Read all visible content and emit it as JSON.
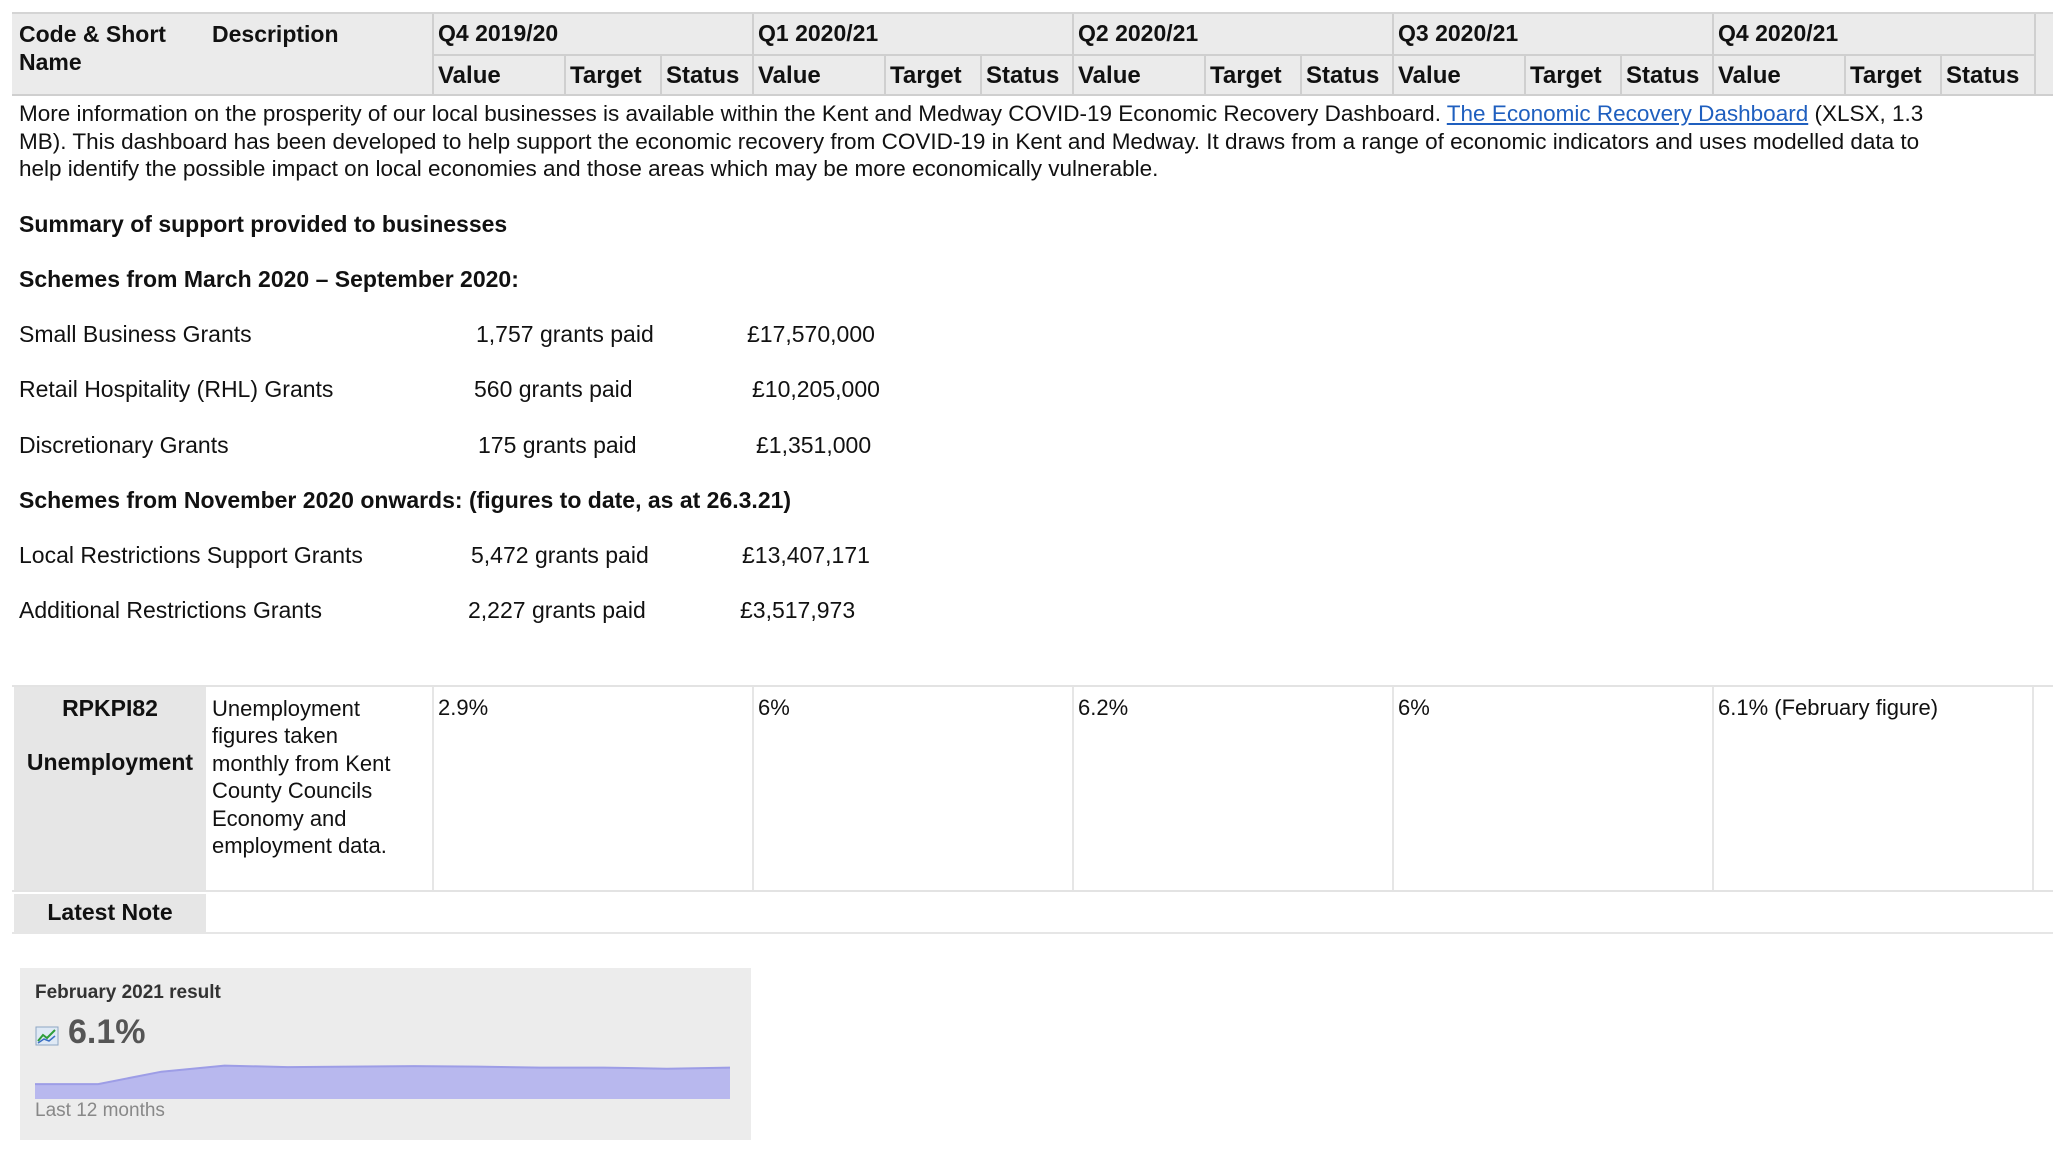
{
  "header": {
    "code_name": "Code & Short Name",
    "description": "Description",
    "quarters": [
      "Q4 2019/20",
      "Q1 2020/21",
      "Q2 2020/21",
      "Q3 2020/21",
      "Q4 2020/21"
    ],
    "sub_value": "Value",
    "sub_target": "Target",
    "sub_status": "Status"
  },
  "intro": {
    "line1_a": "More information on the prosperity of our local businesses is available within the Kent and Medway COVID-19 Economic Recovery Dashboard. ",
    "link": "The Economic Recovery Dashboard",
    "line1_b": " (XLSX, 1.3",
    "line2": "MB). This dashboard has been developed to help support the economic recovery from COVID-19 in Kent and Medway. It draws from a range of economic indicators and uses modelled data to",
    "line3": "help identify the possible impact on local economies and those areas which may be more economically vulnerable."
  },
  "summary_heading": "Summary of support provided to businesses",
  "schemes1_heading": "Schemes from March 2020 – September 2020:",
  "schemes1": [
    {
      "name": "Small Business Grants",
      "count": "1,757 grants paid",
      "amount": "£17,570,000"
    },
    {
      "name": "Retail Hospitality (RHL) Grants",
      "count": "560 grants paid",
      "amount": "£10,205,000"
    },
    {
      "name": "Discretionary Grants",
      "count": "175 grants paid",
      "amount": "£1,351,000"
    }
  ],
  "schemes2_heading": "Schemes from November 2020 onwards:  (figures to date, as at 26.3.21)",
  "schemes2": [
    {
      "name": "Local Restrictions Support Grants",
      "count": "5,472 grants paid",
      "amount": "£13,407,171"
    },
    {
      "name": "Additional Restrictions Grants",
      "count": "2,227 grants paid",
      "amount": "£3,517,973"
    }
  ],
  "kpi": {
    "code": "RPKPI82",
    "name": "Unemployment",
    "description_lines": [
      "Unemployment",
      "figures taken",
      "monthly from Kent",
      "County Councils",
      "Economy and",
      "employment data."
    ],
    "values": [
      "2.9%",
      "6%",
      "6.2%",
      "6%",
      "6.1% (February figure)"
    ],
    "latest_note_label": "Latest Note"
  },
  "spark": {
    "title": "February 2021 result",
    "value": "6.1%",
    "footer": "Last 12 months",
    "icon": "trend-chart-icon",
    "fill_color": "#b8b8ee",
    "line_color": "#9d9de6"
  },
  "chart_data": {
    "type": "area",
    "values": [
      2.9,
      2.9,
      5.3,
      6.5,
      6.2,
      6.3,
      6.4,
      6.3,
      6.1,
      6.1,
      5.9,
      6.1
    ],
    "ylim": [
      0,
      7
    ]
  }
}
